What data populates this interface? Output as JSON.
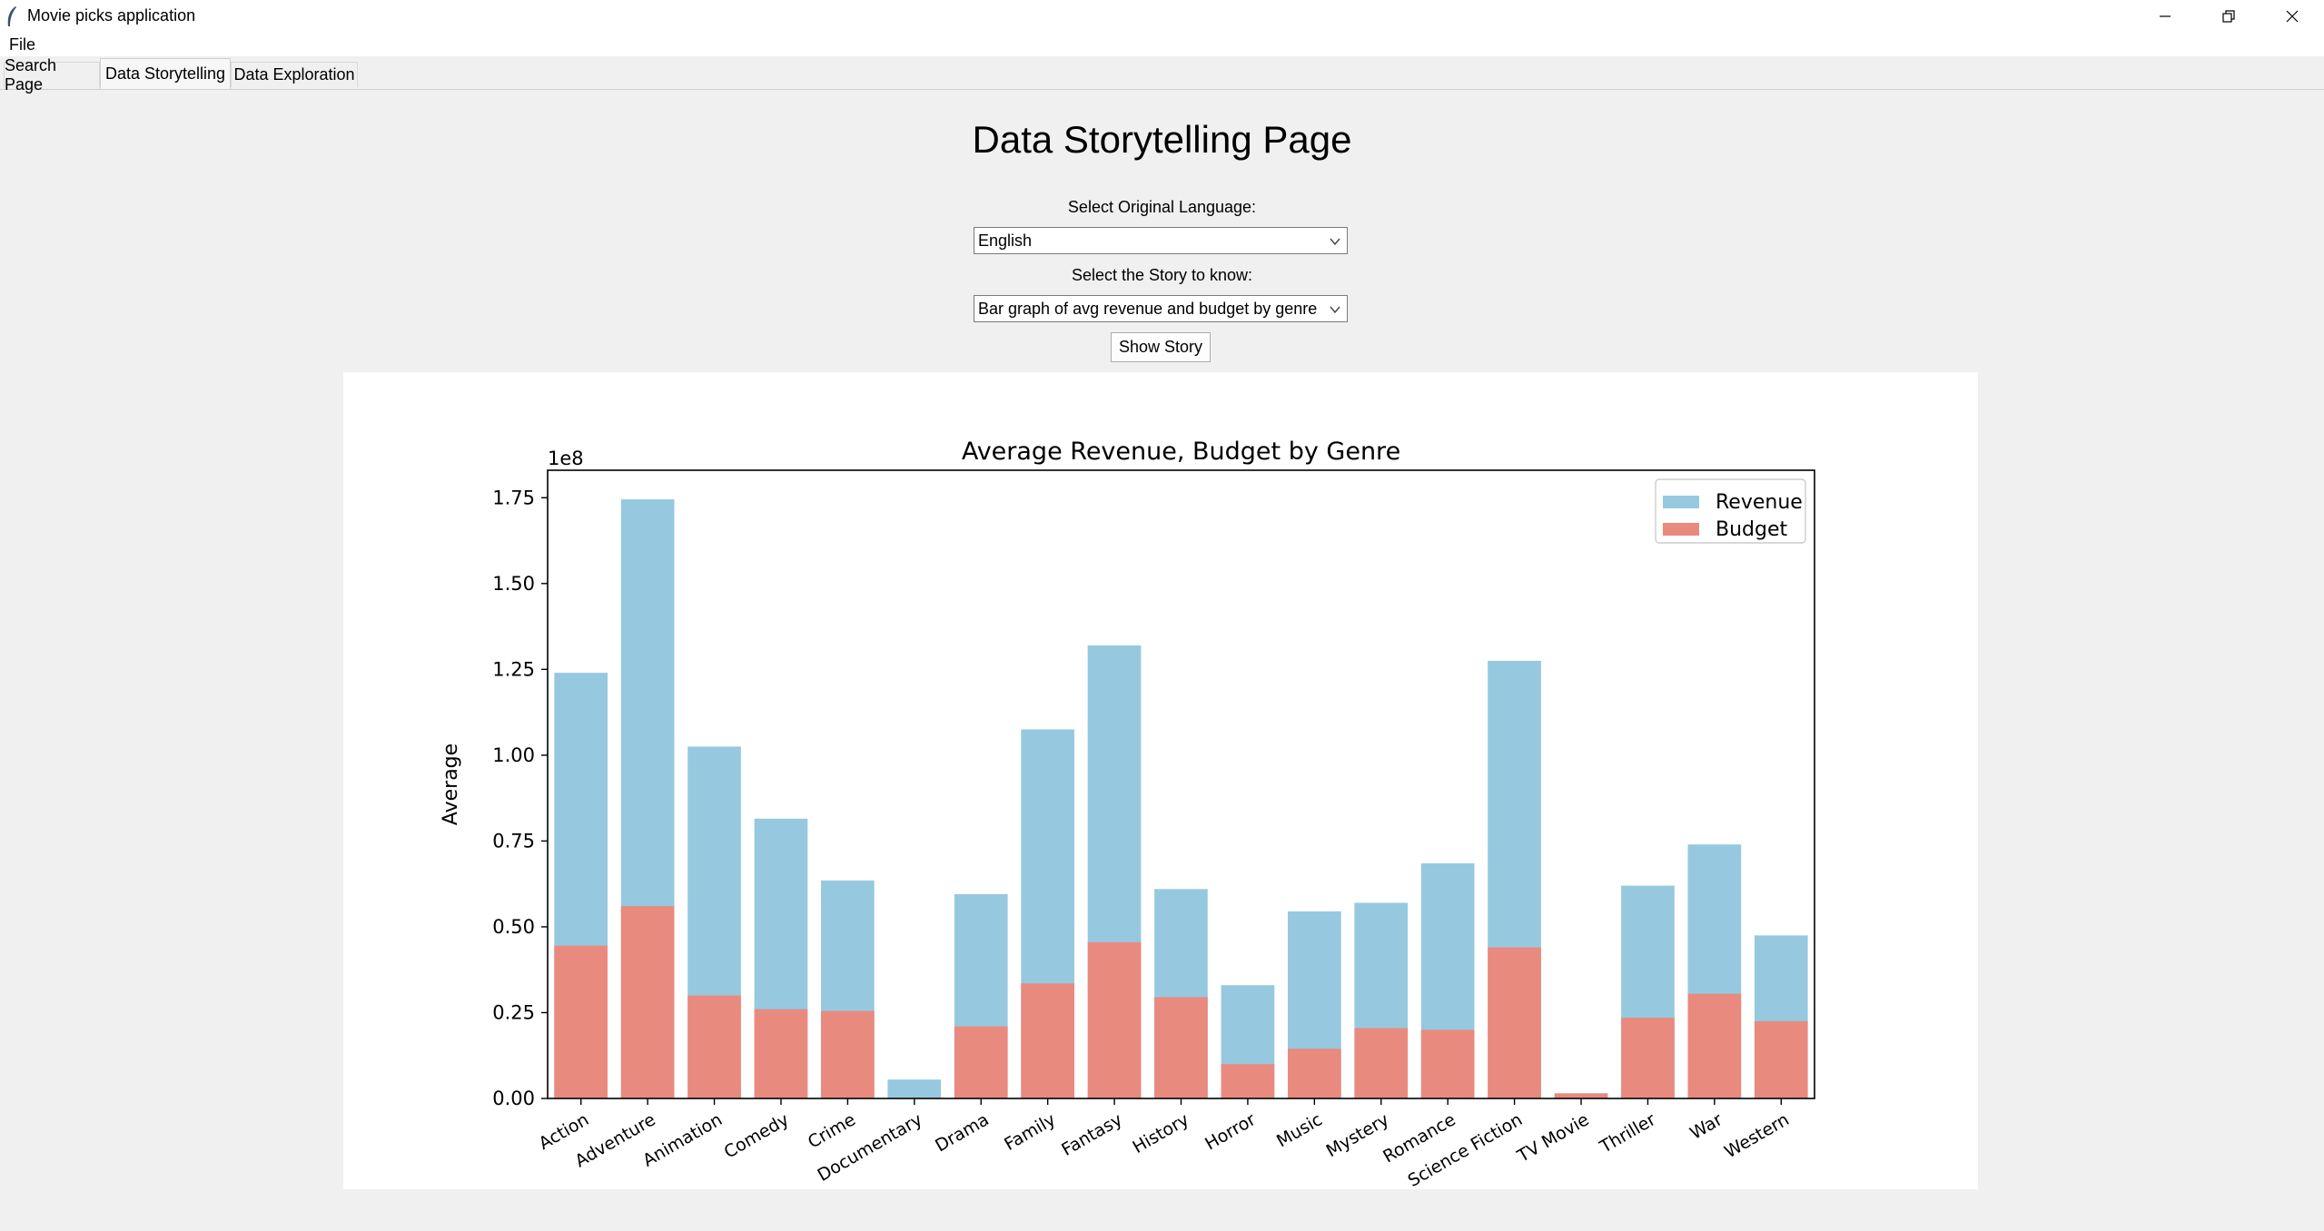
{
  "window": {
    "title": "Movie picks application"
  },
  "menu": {
    "file": "File"
  },
  "tabs": [
    {
      "label": "Search Page"
    },
    {
      "label": "Data Storytelling"
    },
    {
      "label": "Data Exploration"
    }
  ],
  "page": {
    "title": "Data Storytelling Page",
    "language_label": "Select Original Language:",
    "language_value": "English",
    "story_label": "Select the Story to know:",
    "story_value": "Bar graph of avg revenue and budget by genre",
    "show_button": "Show Story"
  },
  "colors": {
    "revenue": "#96c9df",
    "budget": "#e98a7f"
  },
  "chart_data": {
    "type": "bar",
    "title": "Average Revenue, Budget by Genre",
    "xlabel": "",
    "ylabel": "Average",
    "offset_label": "1e8",
    "ylim": [
      0,
      1.83
    ],
    "yticks": [
      "0.00",
      "0.25",
      "0.50",
      "0.75",
      "1.00",
      "1.25",
      "1.50",
      "1.75"
    ],
    "legend_position": "top-right",
    "categories": [
      "Action",
      "Adventure",
      "Animation",
      "Comedy",
      "Crime",
      "Documentary",
      "Drama",
      "Family",
      "Fantasy",
      "History",
      "Horror",
      "Music",
      "Mystery",
      "Romance",
      "Science Fiction",
      "TV Movie",
      "Thriller",
      "War",
      "Western"
    ],
    "series": [
      {
        "name": "Revenue",
        "values": [
          1.24,
          1.745,
          1.025,
          0.815,
          0.635,
          0.055,
          0.595,
          1.075,
          1.32,
          0.61,
          0.33,
          0.545,
          0.57,
          0.685,
          1.275,
          0.01,
          0.62,
          0.74,
          0.475
        ]
      },
      {
        "name": "Budget",
        "values": [
          0.445,
          0.56,
          0.3,
          0.26,
          0.255,
          0.0,
          0.21,
          0.335,
          0.455,
          0.295,
          0.1,
          0.145,
          0.205,
          0.2,
          0.44,
          0.015,
          0.235,
          0.305,
          0.225
        ]
      }
    ]
  }
}
